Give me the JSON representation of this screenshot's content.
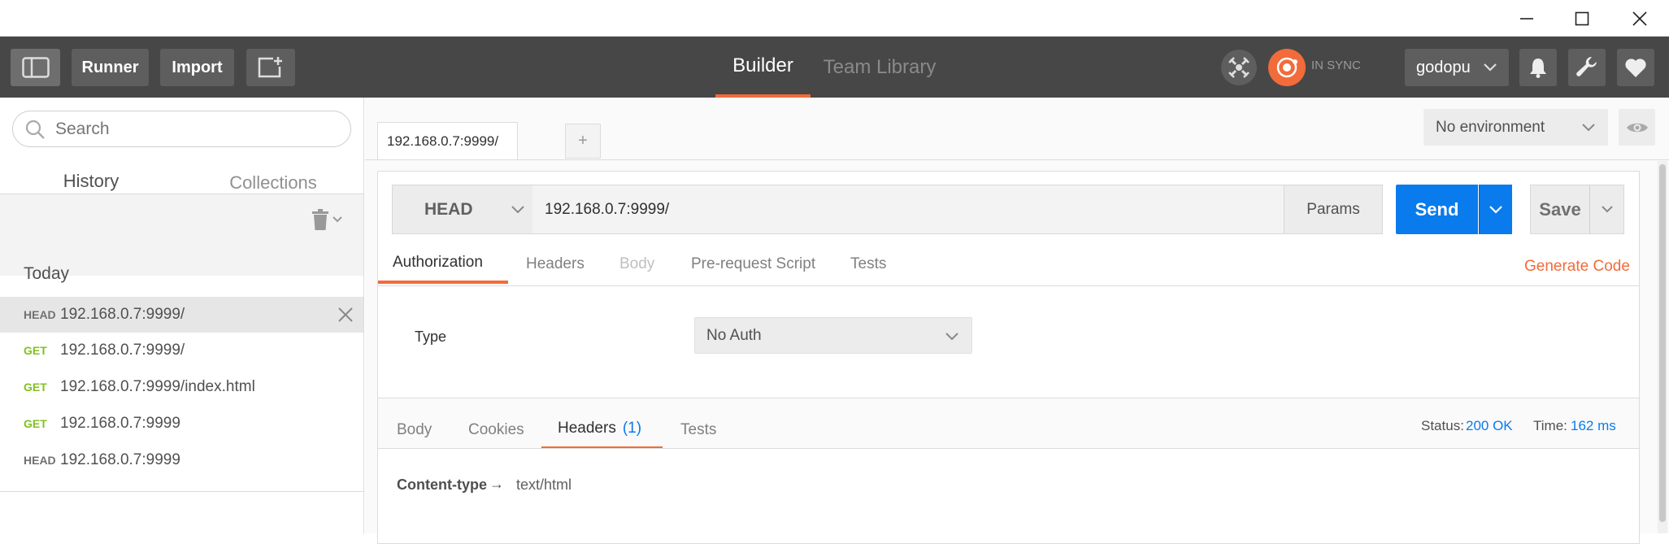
{
  "window": {
    "buttons": [
      "minimize",
      "maximize",
      "close"
    ]
  },
  "header": {
    "runner_label": "Runner",
    "import_label": "Import",
    "tabs": [
      {
        "label": "Builder",
        "active": true
      },
      {
        "label": "Team Library",
        "active": false
      }
    ],
    "sync_status": "IN SYNC",
    "user": "godopu"
  },
  "sidebar": {
    "search_placeholder": "Search",
    "tabs": [
      {
        "label": "History",
        "active": true
      },
      {
        "label": "Collections",
        "active": false
      }
    ],
    "group_label": "Today",
    "history": [
      {
        "method": "HEAD",
        "url": "192.168.0.7:9999/"
      },
      {
        "method": "GET",
        "url": "192.168.0.7:9999/"
      },
      {
        "method": "GET",
        "url": "192.168.0.7:9999/index.html"
      },
      {
        "method": "GET",
        "url": "192.168.0.7:9999"
      },
      {
        "method": "HEAD",
        "url": "192.168.0.7:9999"
      }
    ]
  },
  "main": {
    "request_tab": "192.168.0.7:9999/",
    "add_tab": "+",
    "environment": "No environment",
    "method": "HEAD",
    "url": "192.168.0.7:9999/",
    "params_label": "Params",
    "send_label": "Send",
    "save_label": "Save",
    "request_tabs": [
      "Authorization",
      "Headers",
      "Body",
      "Pre-request Script",
      "Tests"
    ],
    "generate_code": "Generate Code",
    "auth": {
      "type_label": "Type",
      "type_value": "No Auth"
    },
    "response_tabs": [
      "Body",
      "Cookies",
      "Headers",
      "Tests"
    ],
    "headers_count": "(1)",
    "status_label": "Status:",
    "status_value": "200 OK",
    "time_label": "Time:",
    "time_value": "162 ms",
    "response_header": {
      "key": "Content-type",
      "arrow": "→",
      "value": "text/html"
    }
  },
  "colors": {
    "accent": "#f26b3a",
    "blue": "#097bed",
    "get": "#80c21f",
    "header_bg": "#474747"
  }
}
